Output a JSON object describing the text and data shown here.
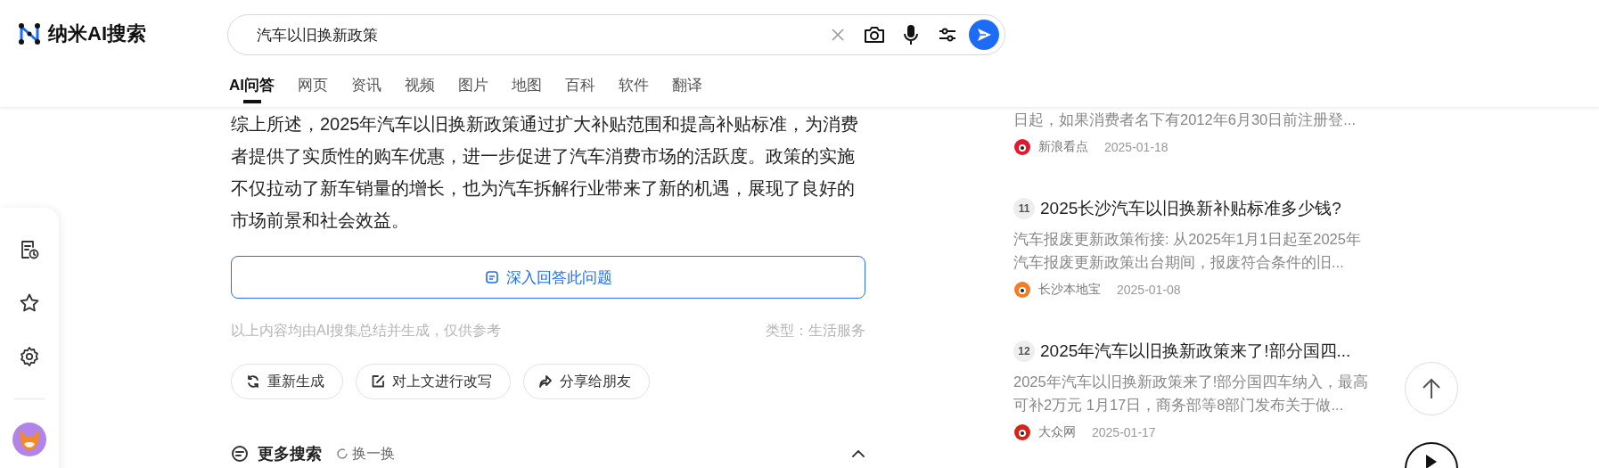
{
  "logo": {
    "text": "纳米AI搜索"
  },
  "search": {
    "value": "汽车以旧换新政策"
  },
  "tabs": [
    {
      "label": "AI问答",
      "selected": true
    },
    {
      "label": "网页",
      "selected": false
    },
    {
      "label": "资讯",
      "selected": false
    },
    {
      "label": "视频",
      "selected": false
    },
    {
      "label": "图片",
      "selected": false
    },
    {
      "label": "地图",
      "selected": false
    },
    {
      "label": "百科",
      "selected": false
    },
    {
      "label": "软件",
      "selected": false
    },
    {
      "label": "翻译",
      "selected": false
    }
  ],
  "answer": {
    "paragraph": "综上所述，2025年汽车以旧换新政策通过扩大补贴范围和提高补贴标准，为消费者提供了实质性的购车优惠，进一步促进了汽车消费市场的活跃度。政策的实施不仅拉动了新车销量的增长，也为汽车拆解行业带来了新的机遇，展现了良好的市场前景和社会效益。",
    "deep_button": "深入回答此问题",
    "disclaimer": "以上内容均由AI搜集总结并生成，仅供参考",
    "category": "类型：生活服务",
    "actions": [
      {
        "kind": "refresh",
        "label": "重新生成"
      },
      {
        "kind": "edit",
        "label": "对上文进行改写"
      },
      {
        "kind": "share",
        "label": "分享给朋友"
      }
    ]
  },
  "more_search": {
    "title": "更多搜索",
    "refresh": "换一换"
  },
  "results": [
    {
      "snippet": "日起，如果消费者名下有2012年6月30日前注册登...",
      "source": "新浪看点",
      "date": "2025-01-18",
      "color": "#e6162d"
    },
    {
      "number": "11",
      "title": "2025长沙汽车以旧换新补贴标准多少钱?",
      "snippet": "汽车报废更新政策衔接: 从2025年1月1日起至2025年汽车报废更新政策出台期间，报废符合条件的旧...",
      "source": "长沙本地宝",
      "date": "2025-01-08",
      "color": "#f57c1f"
    },
    {
      "number": "12",
      "title": "2025年汽车以旧换新政策来了!部分国四...",
      "snippet": "2025年汽车以旧换新政策来了!部分国四车纳入，最高可补2万元 1月17日，商务部等8部门发布关于做...",
      "source": "大众网",
      "date": "2025-01-17",
      "color": "#d8231b"
    }
  ]
}
